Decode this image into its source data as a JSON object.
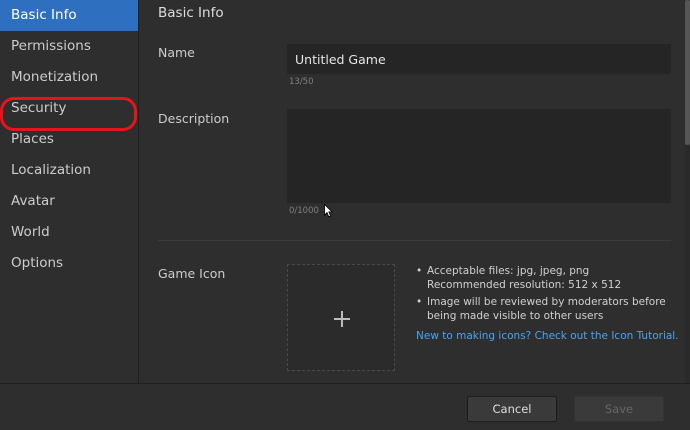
{
  "sidebar": {
    "items": [
      {
        "label": "Basic Info"
      },
      {
        "label": "Permissions"
      },
      {
        "label": "Monetization"
      },
      {
        "label": "Security"
      },
      {
        "label": "Places"
      },
      {
        "label": "Localization"
      },
      {
        "label": "Avatar"
      },
      {
        "label": "World"
      },
      {
        "label": "Options"
      }
    ],
    "active_index": 0,
    "highlighted_item": "Security"
  },
  "main": {
    "title": "Basic Info",
    "name": {
      "label": "Name",
      "value": "Untitled Game",
      "counter": "13/50"
    },
    "description": {
      "label": "Description",
      "value": "",
      "counter": "0/1000"
    },
    "game_icon": {
      "label": "Game Icon",
      "info": [
        "Acceptable files: jpg, jpeg, png",
        "Recommended resolution: 512 x 512",
        "Image will be reviewed by moderators before being made visible to other users"
      ],
      "tutorial_link": "New to making icons? Check out the Icon Tutorial."
    }
  },
  "footer": {
    "cancel_label": "Cancel",
    "save_label": "Save"
  },
  "colors": {
    "accent": "#2f6fbf",
    "annotation": "#e8131b",
    "link": "#4aa3f0",
    "background": "#2e2e2e"
  }
}
